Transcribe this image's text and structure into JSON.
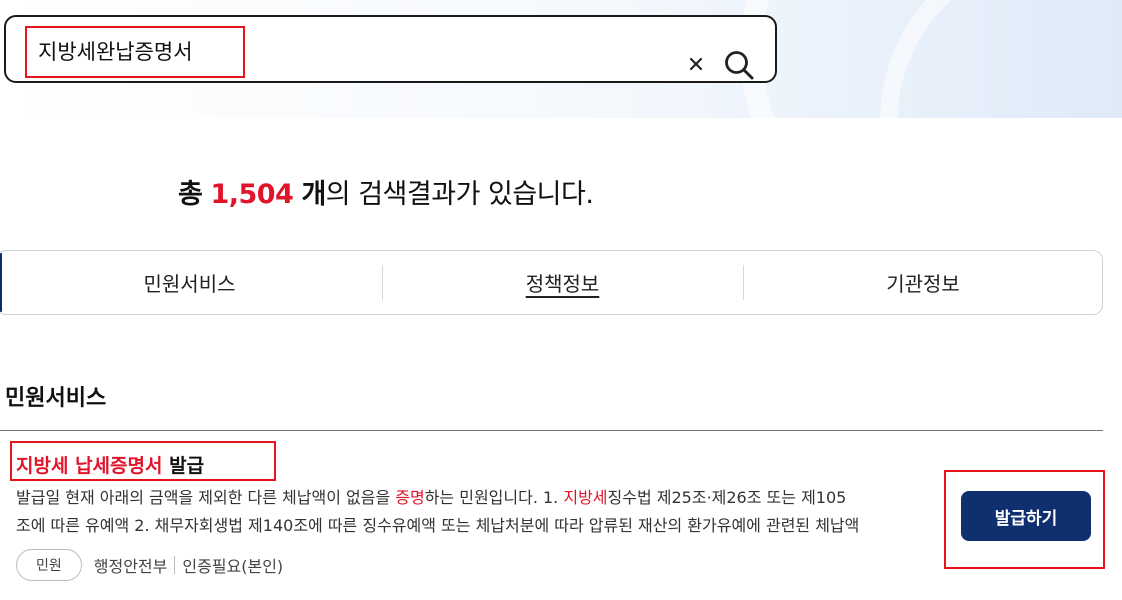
{
  "search": {
    "value": "지방세완납증명서"
  },
  "results": {
    "prefix": "총",
    "count": "1,504",
    "unit": "개",
    "suffix": "의 검색결과가 있습니다."
  },
  "tabs": [
    {
      "label": "민원서비스",
      "active": false
    },
    {
      "label": "정책정보",
      "active": true
    },
    {
      "label": "기관정보",
      "active": false
    }
  ],
  "section": {
    "title": "민원서비스"
  },
  "item": {
    "title_kw1": "지방세",
    "title_kw2": "납세증명서",
    "title_rest": "발급",
    "desc_part1": "발급일 현재 아래의 금액을 제외한 다른 체납액이 없음을 ",
    "desc_kw1": "증명",
    "desc_part2": "하는 민원입니다. 1. ",
    "desc_kw2": "지방세",
    "desc_part3": "징수법 제25조·제26조 또는 제105",
    "desc_line2": "조에 따른 유예액 2. 채무자회생법 제140조에 따른 징수유예액 또는 체납처분에 따라 압류된 재산의 환가유예에 관련된 체납액",
    "badge": "민원",
    "agency": "행정안전부",
    "auth": "인증필요(본인)",
    "button_label": "발급하기"
  },
  "colors": {
    "accent_red": "#e0152b",
    "button_navy": "#0f2f6e",
    "highlight_box": "#e8141c"
  }
}
